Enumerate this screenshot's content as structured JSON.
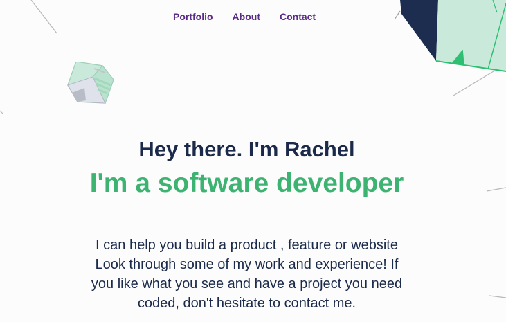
{
  "nav": {
    "items": [
      "Portfolio",
      "About",
      "Contact"
    ]
  },
  "hero": {
    "greeting": "Hey there. I'm Rachel",
    "role": "I'm a software developer",
    "intro_lines": [
      "I can help you build a product , feature or website",
      "Look through some of my work and experience! If",
      "you like what you see and have a project you need",
      "coded, don't hesitate to contact me."
    ]
  },
  "colors": {
    "nav": "#5b2a86",
    "heading": "#1b2a4a",
    "accent": "#3cb371",
    "shape_navy": "#1c2d4f",
    "shape_mint": "#c9eadb",
    "shape_green": "#2fbf72"
  },
  "icons": [
    "cube-icon",
    "geometric-shape-icon"
  ]
}
